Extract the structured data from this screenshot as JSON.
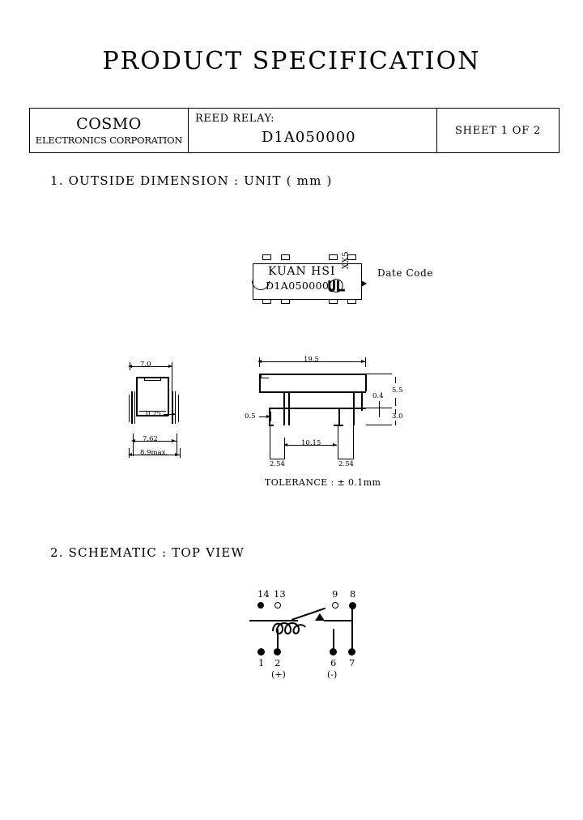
{
  "document": {
    "title": "PRODUCT SPECIFICATION"
  },
  "header": {
    "company_name": "COSMO",
    "company_sub": "ELECTRONICS CORPORATION",
    "product_label": "REED RELAY:",
    "part_number": "D1A050000",
    "sheet": "SHEET 1 OF  2"
  },
  "sections": {
    "outside_dimension": "1. OUTSIDE DIMENSION : UNIT ( mm )",
    "schematic": "2. SCHEMATIC : TOP VIEW"
  },
  "package_top_view": {
    "mark_line1": "KUAN HSI",
    "mark_line2": "D1A050000",
    "ul_logo": "UL",
    "date_code_mark": "XX5",
    "date_code_label": "Date Code"
  },
  "dimensions": {
    "side_view": {
      "width_top": "7.0",
      "lead_thickness": "0.25",
      "lead_span_inner": "7.62",
      "lead_span_outer": "8.9max."
    },
    "front_view": {
      "overall_length": "19.5",
      "lead_seating": "0.5",
      "pin_span": "10.15",
      "pitch_left": "2.54",
      "pitch_right": "2.54",
      "lead_width": "0.4",
      "body_height": "5.5",
      "standoff": "3.0"
    },
    "tolerance_note": "TOLERANCE : ± 0.1mm"
  },
  "schematic": {
    "pins_top": [
      {
        "number": "14",
        "filled": true
      },
      {
        "number": "13",
        "filled": false
      },
      {
        "number": "9",
        "filled": false
      },
      {
        "number": "8",
        "filled": true
      }
    ],
    "pins_bottom": [
      {
        "number": "1",
        "filled": true
      },
      {
        "number": "2",
        "filled": true
      },
      {
        "number": "6",
        "filled": true
      },
      {
        "number": "7",
        "filled": true
      }
    ],
    "polarity_positive": "(+)",
    "polarity_negative": "(-)"
  },
  "colors": {
    "ink": "#000000",
    "paper": "#ffffff"
  }
}
